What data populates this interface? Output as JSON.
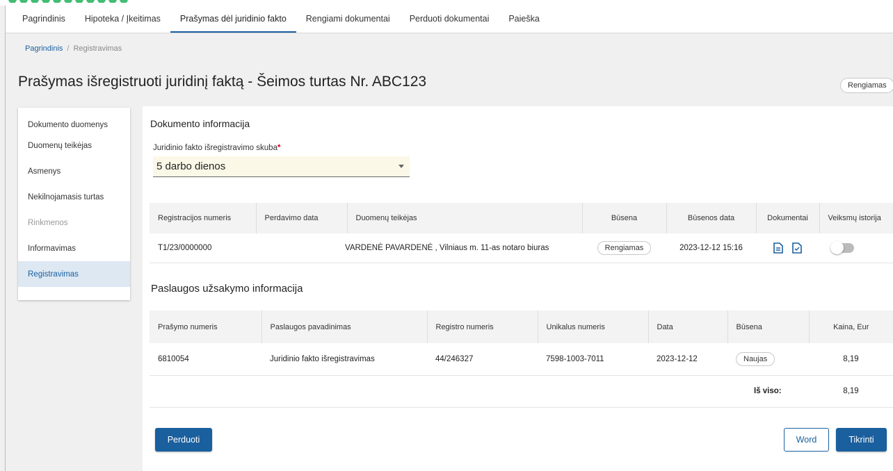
{
  "nav": {
    "tabs": [
      {
        "label": "Pagrindinis"
      },
      {
        "label": "Hipoteka / Įkeitimas"
      },
      {
        "label": "Prašymas dėl juridinio fakto"
      },
      {
        "label": "Rengiami dokumentai"
      },
      {
        "label": "Perduoti dokumentai"
      },
      {
        "label": "Paieška"
      }
    ],
    "active_index": 2
  },
  "breadcrumb": {
    "home": "Pagrindinis",
    "separator": "/",
    "current": "Registravimas"
  },
  "page": {
    "title": "Prašymas išregistruoti juridinį faktą - Šeimos turtas Nr. ABC123",
    "status": "Rengiamas"
  },
  "sidebar": {
    "items": [
      {
        "label": "Dokumento duomenys",
        "state": "normal"
      },
      {
        "label": "Duomenų teikėjas",
        "state": "normal"
      },
      {
        "label": "Asmenys",
        "state": "normal"
      },
      {
        "label": "Nekilnojamasis turtas",
        "state": "normal"
      },
      {
        "label": "Rinkmenos",
        "state": "disabled"
      },
      {
        "label": "Informavimas",
        "state": "normal"
      },
      {
        "label": "Registravimas",
        "state": "active"
      }
    ]
  },
  "doc_info": {
    "title": "Dokumento informacija",
    "urgency_label": "Juridinio fakto išregistravimo skuba",
    "required_mark": "*",
    "urgency_value": "5 darbo dienos",
    "table": {
      "headers": [
        "Registracijos numeris",
        "Perdavimo data",
        "Duomenų teikėjas",
        "Būsena",
        "Būsenos data",
        "Dokumentai",
        "Veiksmų istorija"
      ],
      "row": {
        "reg_number": "T1/23/0000000",
        "transfer_date": "",
        "provider": "VARDENĖ PAVARDENĖ , Vilniaus m. 11-as notaro biuras",
        "status": "Rengiamas",
        "status_date": "2023-12-12 15:16",
        "documents": [
          "document-icon",
          "document-check-icon"
        ],
        "history_toggle": "off"
      }
    }
  },
  "service_info": {
    "title": "Paslaugos užsakymo informacija",
    "table": {
      "headers": [
        "Prašymo numeris",
        "Paslaugos pavadinimas",
        "Registro numeris",
        "Unikalus numeris",
        "Data",
        "Būsena",
        "Kaina, Eur"
      ],
      "rows": [
        {
          "request_no": "6810054",
          "service": "Juridinio fakto išregistravimas",
          "register_no": "44/246327",
          "unique_no": "7598-1003-7011",
          "date": "2023-12-12",
          "status": "Naujas",
          "price": "8,19"
        }
      ],
      "total_label": "Iš viso:",
      "total_value": "8,19"
    }
  },
  "actions": {
    "transfer": "Perduoti",
    "word": "Word",
    "check": "Tikrinti"
  },
  "colors": {
    "accent": "#1a5f9e",
    "active_bg": "#dde8f3",
    "field_bg": "#fcf8e8"
  }
}
